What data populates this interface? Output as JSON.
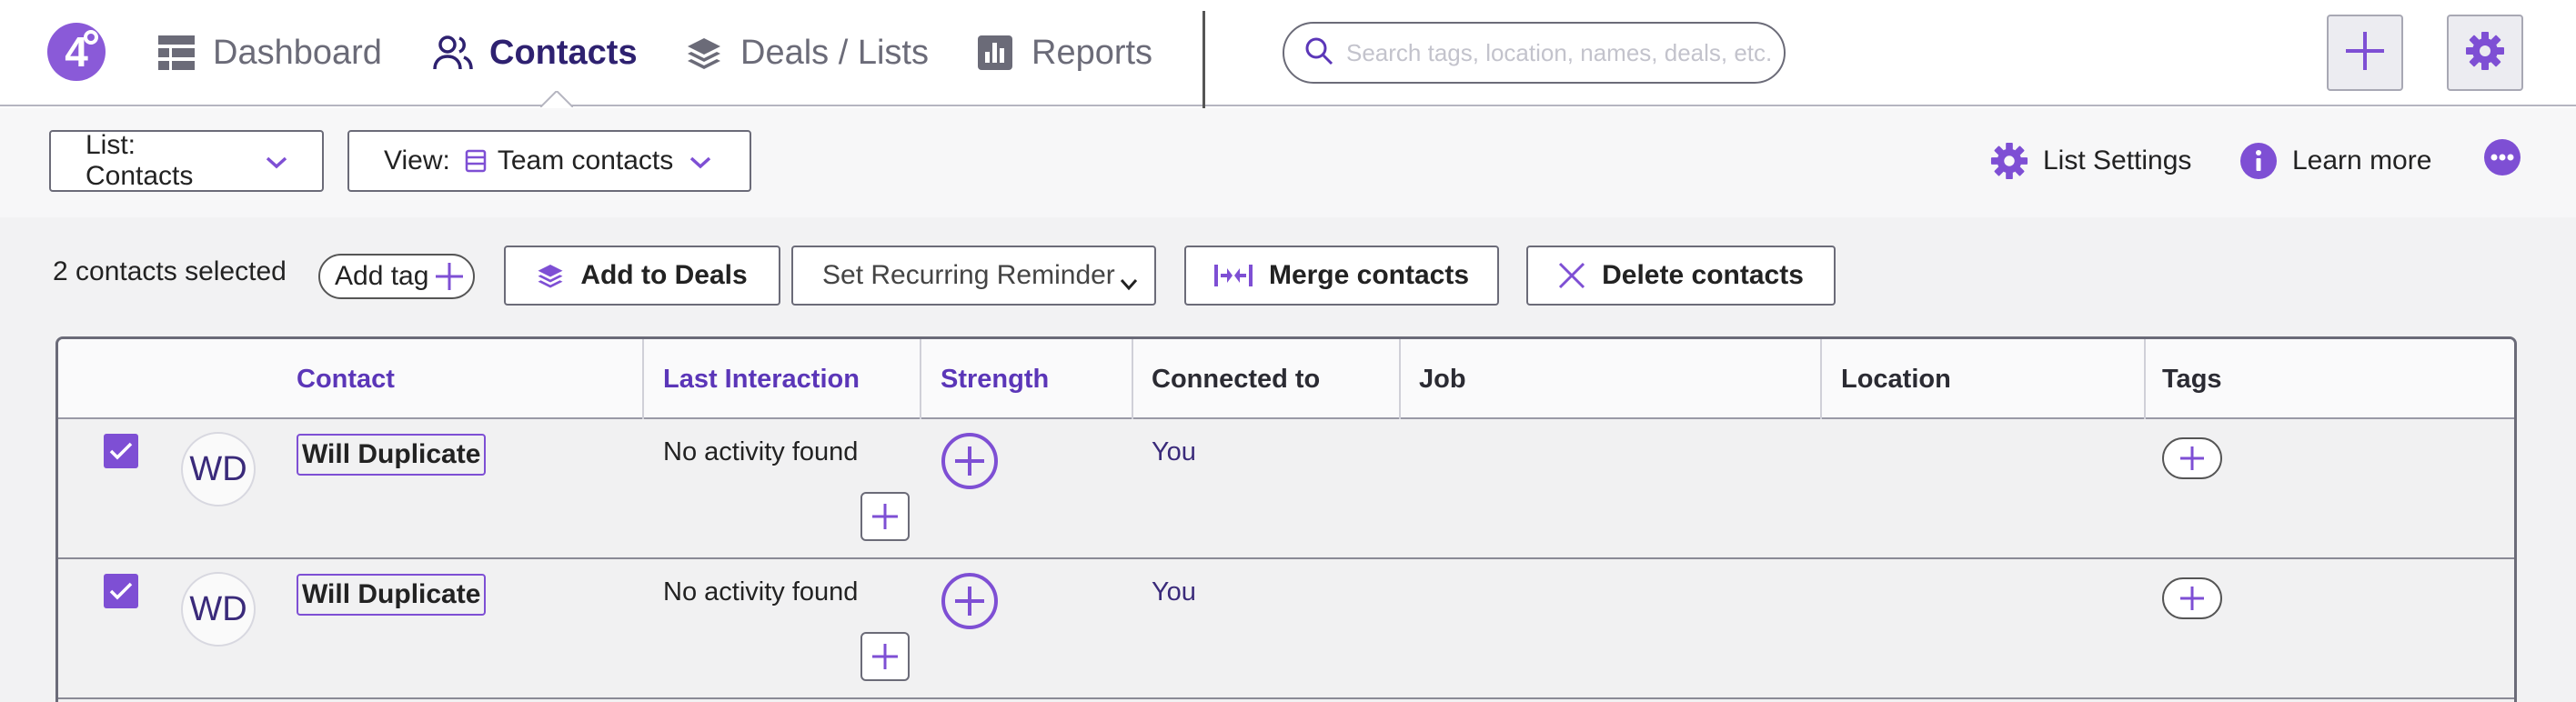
{
  "colors": {
    "accent": "#7e4fd4",
    "nav_active": "#2e2170",
    "muted": "#6b6b78"
  },
  "nav": {
    "logo_text": "4",
    "items": [
      {
        "label": "Dashboard",
        "icon": "dashboard-grid-icon",
        "active": false
      },
      {
        "label": "Contacts",
        "icon": "contacts-people-icon",
        "active": true
      },
      {
        "label": "Deals / Lists",
        "icon": "stack-layers-icon",
        "active": false
      },
      {
        "label": "Reports",
        "icon": "bar-chart-icon",
        "active": false
      }
    ],
    "search_placeholder": "Search tags, location, names, deals, etc.",
    "add_button_icon": "plus-icon",
    "settings_button_icon": "gear-icon"
  },
  "subbar": {
    "list_label": "List: Contacts",
    "view_prefix": "View:",
    "view_label": "Team contacts",
    "list_settings": "List Settings",
    "learn_more": "Learn more"
  },
  "actions": {
    "selected_text": "2 contacts selected",
    "add_tag": "Add tag",
    "add_to_deals": "Add to Deals",
    "reminder_selected": "Set Recurring Reminder",
    "merge": "Merge contacts",
    "delete": "Delete contacts"
  },
  "table": {
    "headers": [
      "Contact",
      "Last Interaction",
      "Strength",
      "Connected to",
      "Job",
      "Location",
      "Tags"
    ],
    "rows": [
      {
        "checked": true,
        "initials": "WD",
        "name": "Will Duplicate",
        "last_interaction": "No activity found",
        "connected_to": "You",
        "job": "",
        "location": ""
      },
      {
        "checked": true,
        "initials": "WD",
        "name": "Will Duplicate",
        "last_interaction": "No activity found",
        "connected_to": "You",
        "job": "",
        "location": ""
      }
    ]
  }
}
